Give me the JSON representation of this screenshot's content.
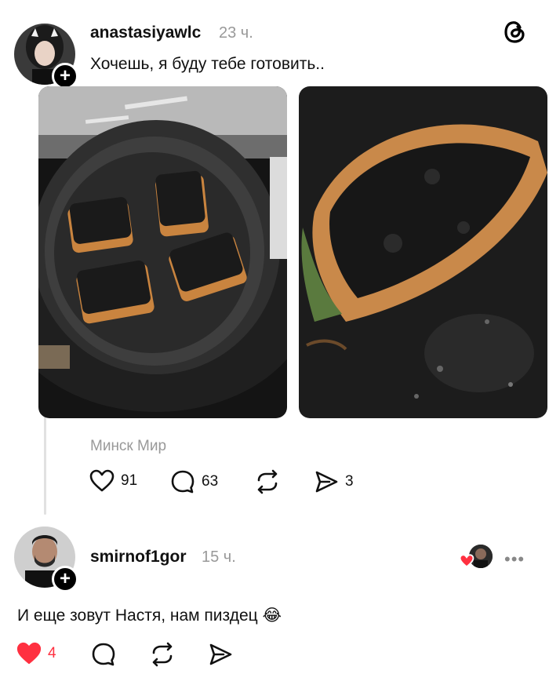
{
  "post": {
    "username": "anastasiyawlc",
    "time": "23 ч.",
    "text": "Хочешь, я буду тебе готовить..",
    "location": "Минск Мир",
    "likes": "91",
    "comments": "63",
    "shares": "3",
    "icons": [
      "threads-logo-icon",
      "heart-icon",
      "comment-icon",
      "repost-icon",
      "share-icon",
      "plus-icon"
    ]
  },
  "reply": {
    "username": "smirnof1gor",
    "time": "15 ч.",
    "text": "И еще зовут Настя, нам пиздец 😂",
    "likes": "4",
    "liked": true,
    "more_label": "•••",
    "like_color": "#ff3040"
  }
}
